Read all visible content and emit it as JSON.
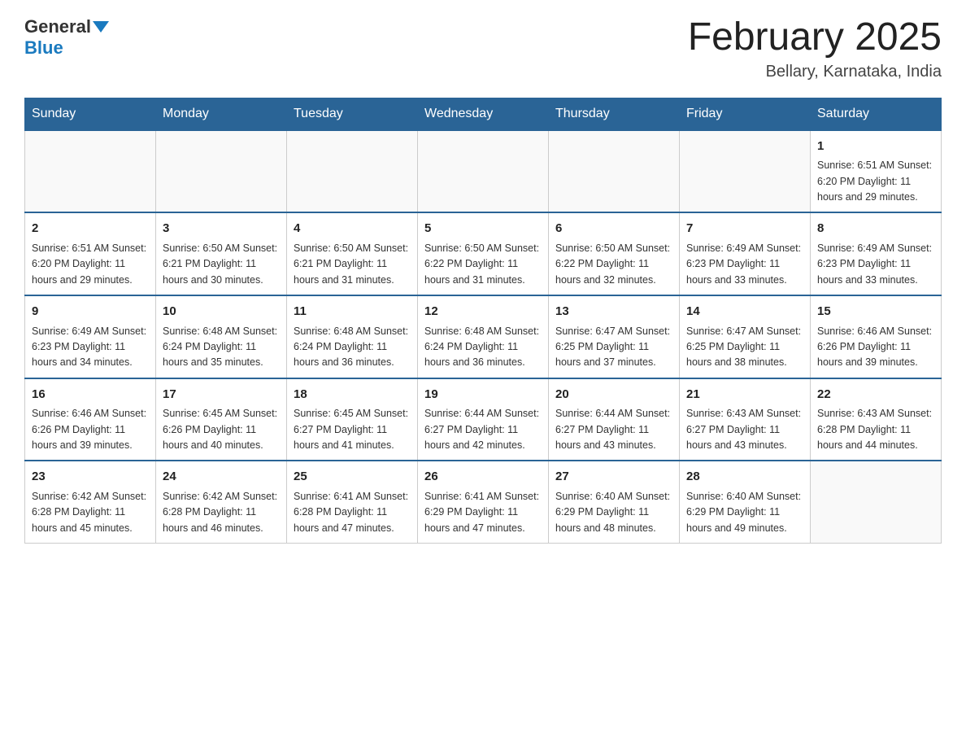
{
  "header": {
    "logo_general": "General",
    "logo_blue": "Blue",
    "month_title": "February 2025",
    "location": "Bellary, Karnataka, India"
  },
  "weekdays": [
    "Sunday",
    "Monday",
    "Tuesday",
    "Wednesday",
    "Thursday",
    "Friday",
    "Saturday"
  ],
  "weeks": [
    [
      {
        "day": "",
        "info": ""
      },
      {
        "day": "",
        "info": ""
      },
      {
        "day": "",
        "info": ""
      },
      {
        "day": "",
        "info": ""
      },
      {
        "day": "",
        "info": ""
      },
      {
        "day": "",
        "info": ""
      },
      {
        "day": "1",
        "info": "Sunrise: 6:51 AM\nSunset: 6:20 PM\nDaylight: 11 hours\nand 29 minutes."
      }
    ],
    [
      {
        "day": "2",
        "info": "Sunrise: 6:51 AM\nSunset: 6:20 PM\nDaylight: 11 hours\nand 29 minutes."
      },
      {
        "day": "3",
        "info": "Sunrise: 6:50 AM\nSunset: 6:21 PM\nDaylight: 11 hours\nand 30 minutes."
      },
      {
        "day": "4",
        "info": "Sunrise: 6:50 AM\nSunset: 6:21 PM\nDaylight: 11 hours\nand 31 minutes."
      },
      {
        "day": "5",
        "info": "Sunrise: 6:50 AM\nSunset: 6:22 PM\nDaylight: 11 hours\nand 31 minutes."
      },
      {
        "day": "6",
        "info": "Sunrise: 6:50 AM\nSunset: 6:22 PM\nDaylight: 11 hours\nand 32 minutes."
      },
      {
        "day": "7",
        "info": "Sunrise: 6:49 AM\nSunset: 6:23 PM\nDaylight: 11 hours\nand 33 minutes."
      },
      {
        "day": "8",
        "info": "Sunrise: 6:49 AM\nSunset: 6:23 PM\nDaylight: 11 hours\nand 33 minutes."
      }
    ],
    [
      {
        "day": "9",
        "info": "Sunrise: 6:49 AM\nSunset: 6:23 PM\nDaylight: 11 hours\nand 34 minutes."
      },
      {
        "day": "10",
        "info": "Sunrise: 6:48 AM\nSunset: 6:24 PM\nDaylight: 11 hours\nand 35 minutes."
      },
      {
        "day": "11",
        "info": "Sunrise: 6:48 AM\nSunset: 6:24 PM\nDaylight: 11 hours\nand 36 minutes."
      },
      {
        "day": "12",
        "info": "Sunrise: 6:48 AM\nSunset: 6:24 PM\nDaylight: 11 hours\nand 36 minutes."
      },
      {
        "day": "13",
        "info": "Sunrise: 6:47 AM\nSunset: 6:25 PM\nDaylight: 11 hours\nand 37 minutes."
      },
      {
        "day": "14",
        "info": "Sunrise: 6:47 AM\nSunset: 6:25 PM\nDaylight: 11 hours\nand 38 minutes."
      },
      {
        "day": "15",
        "info": "Sunrise: 6:46 AM\nSunset: 6:26 PM\nDaylight: 11 hours\nand 39 minutes."
      }
    ],
    [
      {
        "day": "16",
        "info": "Sunrise: 6:46 AM\nSunset: 6:26 PM\nDaylight: 11 hours\nand 39 minutes."
      },
      {
        "day": "17",
        "info": "Sunrise: 6:45 AM\nSunset: 6:26 PM\nDaylight: 11 hours\nand 40 minutes."
      },
      {
        "day": "18",
        "info": "Sunrise: 6:45 AM\nSunset: 6:27 PM\nDaylight: 11 hours\nand 41 minutes."
      },
      {
        "day": "19",
        "info": "Sunrise: 6:44 AM\nSunset: 6:27 PM\nDaylight: 11 hours\nand 42 minutes."
      },
      {
        "day": "20",
        "info": "Sunrise: 6:44 AM\nSunset: 6:27 PM\nDaylight: 11 hours\nand 43 minutes."
      },
      {
        "day": "21",
        "info": "Sunrise: 6:43 AM\nSunset: 6:27 PM\nDaylight: 11 hours\nand 43 minutes."
      },
      {
        "day": "22",
        "info": "Sunrise: 6:43 AM\nSunset: 6:28 PM\nDaylight: 11 hours\nand 44 minutes."
      }
    ],
    [
      {
        "day": "23",
        "info": "Sunrise: 6:42 AM\nSunset: 6:28 PM\nDaylight: 11 hours\nand 45 minutes."
      },
      {
        "day": "24",
        "info": "Sunrise: 6:42 AM\nSunset: 6:28 PM\nDaylight: 11 hours\nand 46 minutes."
      },
      {
        "day": "25",
        "info": "Sunrise: 6:41 AM\nSunset: 6:28 PM\nDaylight: 11 hours\nand 47 minutes."
      },
      {
        "day": "26",
        "info": "Sunrise: 6:41 AM\nSunset: 6:29 PM\nDaylight: 11 hours\nand 47 minutes."
      },
      {
        "day": "27",
        "info": "Sunrise: 6:40 AM\nSunset: 6:29 PM\nDaylight: 11 hours\nand 48 minutes."
      },
      {
        "day": "28",
        "info": "Sunrise: 6:40 AM\nSunset: 6:29 PM\nDaylight: 11 hours\nand 49 minutes."
      },
      {
        "day": "",
        "info": ""
      }
    ]
  ]
}
